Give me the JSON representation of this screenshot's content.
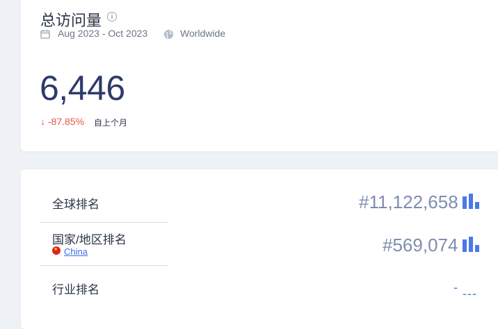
{
  "header": {
    "title": "总访问量",
    "date_range": "Aug 2023 - Oct 2023",
    "region": "Worldwide"
  },
  "visits": {
    "value": "6,446",
    "change": "↓ -87.85%",
    "change_suffix": "自上个月"
  },
  "rankings": {
    "global": {
      "label": "全球排名",
      "value": "#11,122,658"
    },
    "country": {
      "label": "国家/地区排名",
      "country": "China",
      "value": "#569,074"
    },
    "industry": {
      "label": "行业排名",
      "value": "-",
      "sub": "---"
    }
  },
  "colors": {
    "accent": "#4a78e8",
    "negative": "#e8563f",
    "number": "#2d3a6b"
  },
  "icons": {
    "info": "info-icon",
    "calendar": "calendar-icon",
    "globe": "globe-icon",
    "bars": "bar-chart-icon",
    "flag": "china-flag-icon"
  }
}
